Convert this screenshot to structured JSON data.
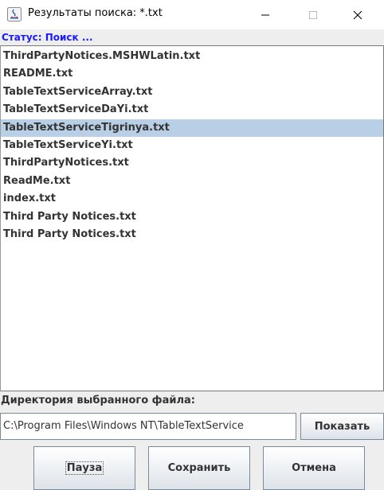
{
  "window": {
    "title": "Результаты поиска: *.txt"
  },
  "status": {
    "text": "Статус: Поиск ..."
  },
  "files": [
    {
      "name": "ThirdPartyNotices.MSHWLatin.txt",
      "selected": false
    },
    {
      "name": "README.txt",
      "selected": false
    },
    {
      "name": "TableTextServiceArray.txt",
      "selected": false
    },
    {
      "name": "TableTextServiceDaYi.txt",
      "selected": false
    },
    {
      "name": "TableTextServiceTigrinya.txt",
      "selected": true
    },
    {
      "name": "TableTextServiceYi.txt",
      "selected": false
    },
    {
      "name": "ThirdPartyNotices.txt",
      "selected": false
    },
    {
      "name": "ReadMe.txt",
      "selected": false
    },
    {
      "name": "index.txt",
      "selected": false
    },
    {
      "name": "Third Party Notices.txt",
      "selected": false
    },
    {
      "name": "Third Party Notices.txt",
      "selected": false
    }
  ],
  "directory": {
    "label": "Директория выбранного файла:",
    "path": "C:\\Program Files\\Windows NT\\TableTextService",
    "show_label": "Показать"
  },
  "actions": {
    "pause_label": "Пауза",
    "save_label": "Сохранить",
    "cancel_label": "Отмена"
  },
  "colors": {
    "status": "#1a1aff",
    "selection": "#b8cfe5"
  }
}
